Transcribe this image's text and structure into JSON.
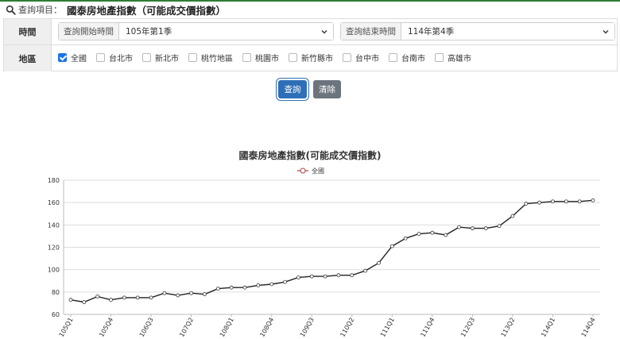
{
  "header": {
    "query_label": "查詢項目：",
    "query_value": "國泰房地產指數（可能成交價指數）"
  },
  "form": {
    "time_label": "時間",
    "start_addon": "查詢開始時間",
    "start_value": "105年第1季",
    "end_addon": "查詢結束時間",
    "end_value": "114年第4季",
    "region_label": "地區",
    "regions": [
      {
        "label": "全國",
        "checked": true
      },
      {
        "label": "台北市",
        "checked": false
      },
      {
        "label": "新北市",
        "checked": false
      },
      {
        "label": "桃竹地區",
        "checked": false
      },
      {
        "label": "桃園市",
        "checked": false
      },
      {
        "label": "新竹縣市",
        "checked": false
      },
      {
        "label": "台中市",
        "checked": false
      },
      {
        "label": "台南市",
        "checked": false
      },
      {
        "label": "高雄市",
        "checked": false
      }
    ]
  },
  "buttons": {
    "query": "查詢",
    "clear": "清除"
  },
  "chart_data": {
    "type": "line",
    "title": "國泰房地產指數(可能成交價指數)",
    "xlabel": "",
    "ylabel": "",
    "ylim": [
      60,
      180
    ],
    "yticks": [
      60,
      80,
      100,
      120,
      140,
      160,
      180
    ],
    "grid": true,
    "legend_position": "top-center",
    "x": [
      "105Q1",
      "105Q2",
      "105Q3",
      "105Q4",
      "106Q1",
      "106Q2",
      "106Q3",
      "106Q4",
      "107Q1",
      "107Q2",
      "107Q3",
      "107Q4",
      "108Q1",
      "108Q2",
      "108Q3",
      "108Q4",
      "109Q1",
      "109Q2",
      "109Q3",
      "109Q4",
      "110Q1",
      "110Q2",
      "110Q3",
      "110Q4",
      "111Q1",
      "111Q2",
      "111Q3",
      "111Q4",
      "112Q1",
      "112Q2",
      "112Q3",
      "112Q4",
      "113Q1",
      "113Q2",
      "113Q3",
      "113Q4",
      "114Q1",
      "114Q2",
      "114Q3",
      "114Q4"
    ],
    "xtick_labels": [
      "105Q1",
      "105Q4",
      "106Q3",
      "107Q2",
      "108Q1",
      "108Q4",
      "109Q3",
      "110Q2",
      "111Q1",
      "111Q4",
      "112Q3",
      "113Q2",
      "114Q1",
      "114Q4"
    ],
    "series": [
      {
        "name": "全國",
        "color": "#a94442",
        "values": [
          73,
          71,
          76,
          73,
          75,
          75,
          75,
          79,
          77,
          79,
          78,
          83,
          84,
          84,
          86,
          87,
          89,
          93,
          94,
          94,
          95,
          95,
          99,
          106,
          121,
          128,
          132,
          133,
          131,
          138,
          137,
          137,
          139,
          148,
          159,
          160,
          161,
          161,
          161,
          162
        ]
      }
    ]
  },
  "colors": {
    "accent": "#2f6fb8",
    "clear": "#6c757d",
    "line": "#222222",
    "marker_edge": "#a94442"
  }
}
